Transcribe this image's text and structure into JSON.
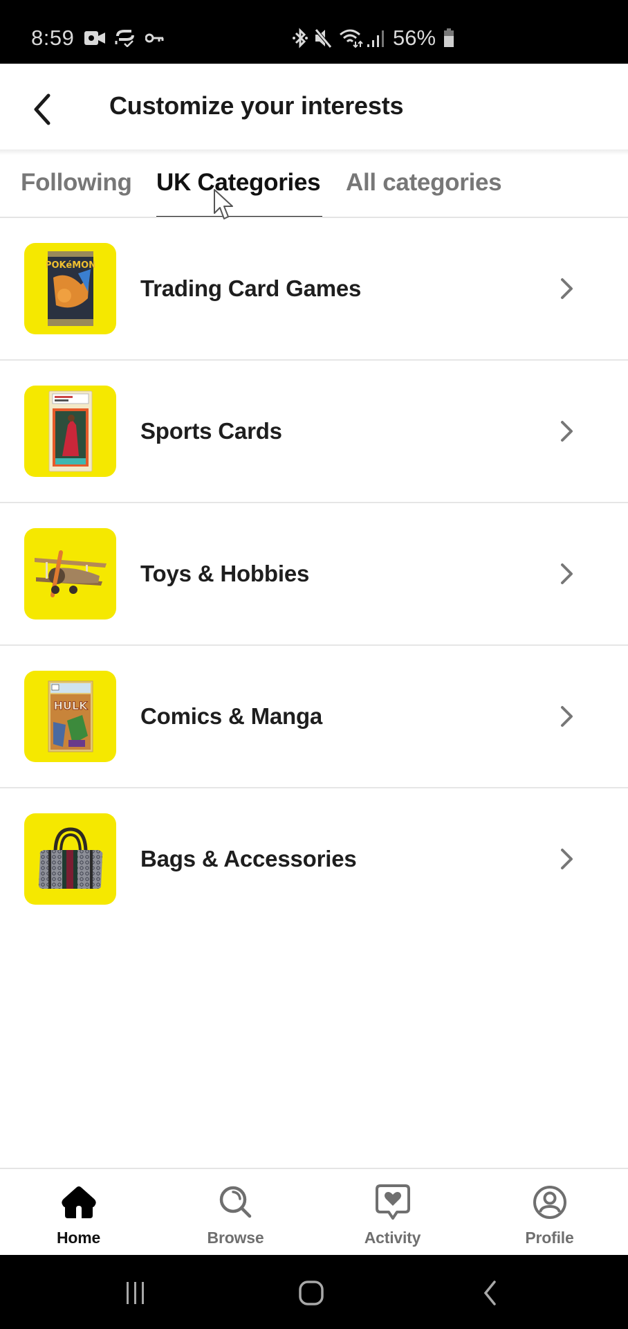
{
  "status_bar": {
    "time": "8:59",
    "left_icons": [
      "video-camera-icon",
      "sync-check-icon",
      "vpn-key-icon"
    ],
    "right_icons": [
      "bluetooth-icon",
      "mute-icon",
      "wifi-icon",
      "signal-icon",
      "battery-icon"
    ],
    "battery_percent": "56%"
  },
  "header": {
    "back_icon": "chevron-left-icon",
    "title": "Customize your interests"
  },
  "tabs": {
    "items": [
      {
        "label": "Following",
        "active": false
      },
      {
        "label": "UK Categories",
        "active": true
      },
      {
        "label": "All categories",
        "active": false
      }
    ]
  },
  "categories": {
    "items": [
      {
        "label": "Trading Card Games",
        "image": "pokemon-booster-pack",
        "tile_color": "#f5e800"
      },
      {
        "label": "Sports Cards",
        "image": "graded-basketball-card",
        "tile_color": "#f5e800"
      },
      {
        "label": "Toys & Hobbies",
        "image": "toy-biplane",
        "tile_color": "#f5e800"
      },
      {
        "label": "Comics & Manga",
        "image": "graded-hulk-comic",
        "tile_color": "#f5e800"
      },
      {
        "label": "Bags & Accessories",
        "image": "monogram-duffel-bag",
        "tile_color": "#f5e800"
      }
    ]
  },
  "bottom_nav": {
    "items": [
      {
        "label": "Home",
        "icon": "home-icon",
        "active": true
      },
      {
        "label": "Browse",
        "icon": "search-icon",
        "active": false
      },
      {
        "label": "Activity",
        "icon": "activity-heart-icon",
        "active": false
      },
      {
        "label": "Profile",
        "icon": "profile-icon",
        "active": false
      }
    ]
  },
  "system_nav": {
    "buttons": [
      "recent-apps-icon",
      "home-circle-icon",
      "back-icon"
    ]
  },
  "colors": {
    "accent_tile": "#f5e800",
    "active_text": "#111111",
    "inactive_text": "#777777"
  }
}
